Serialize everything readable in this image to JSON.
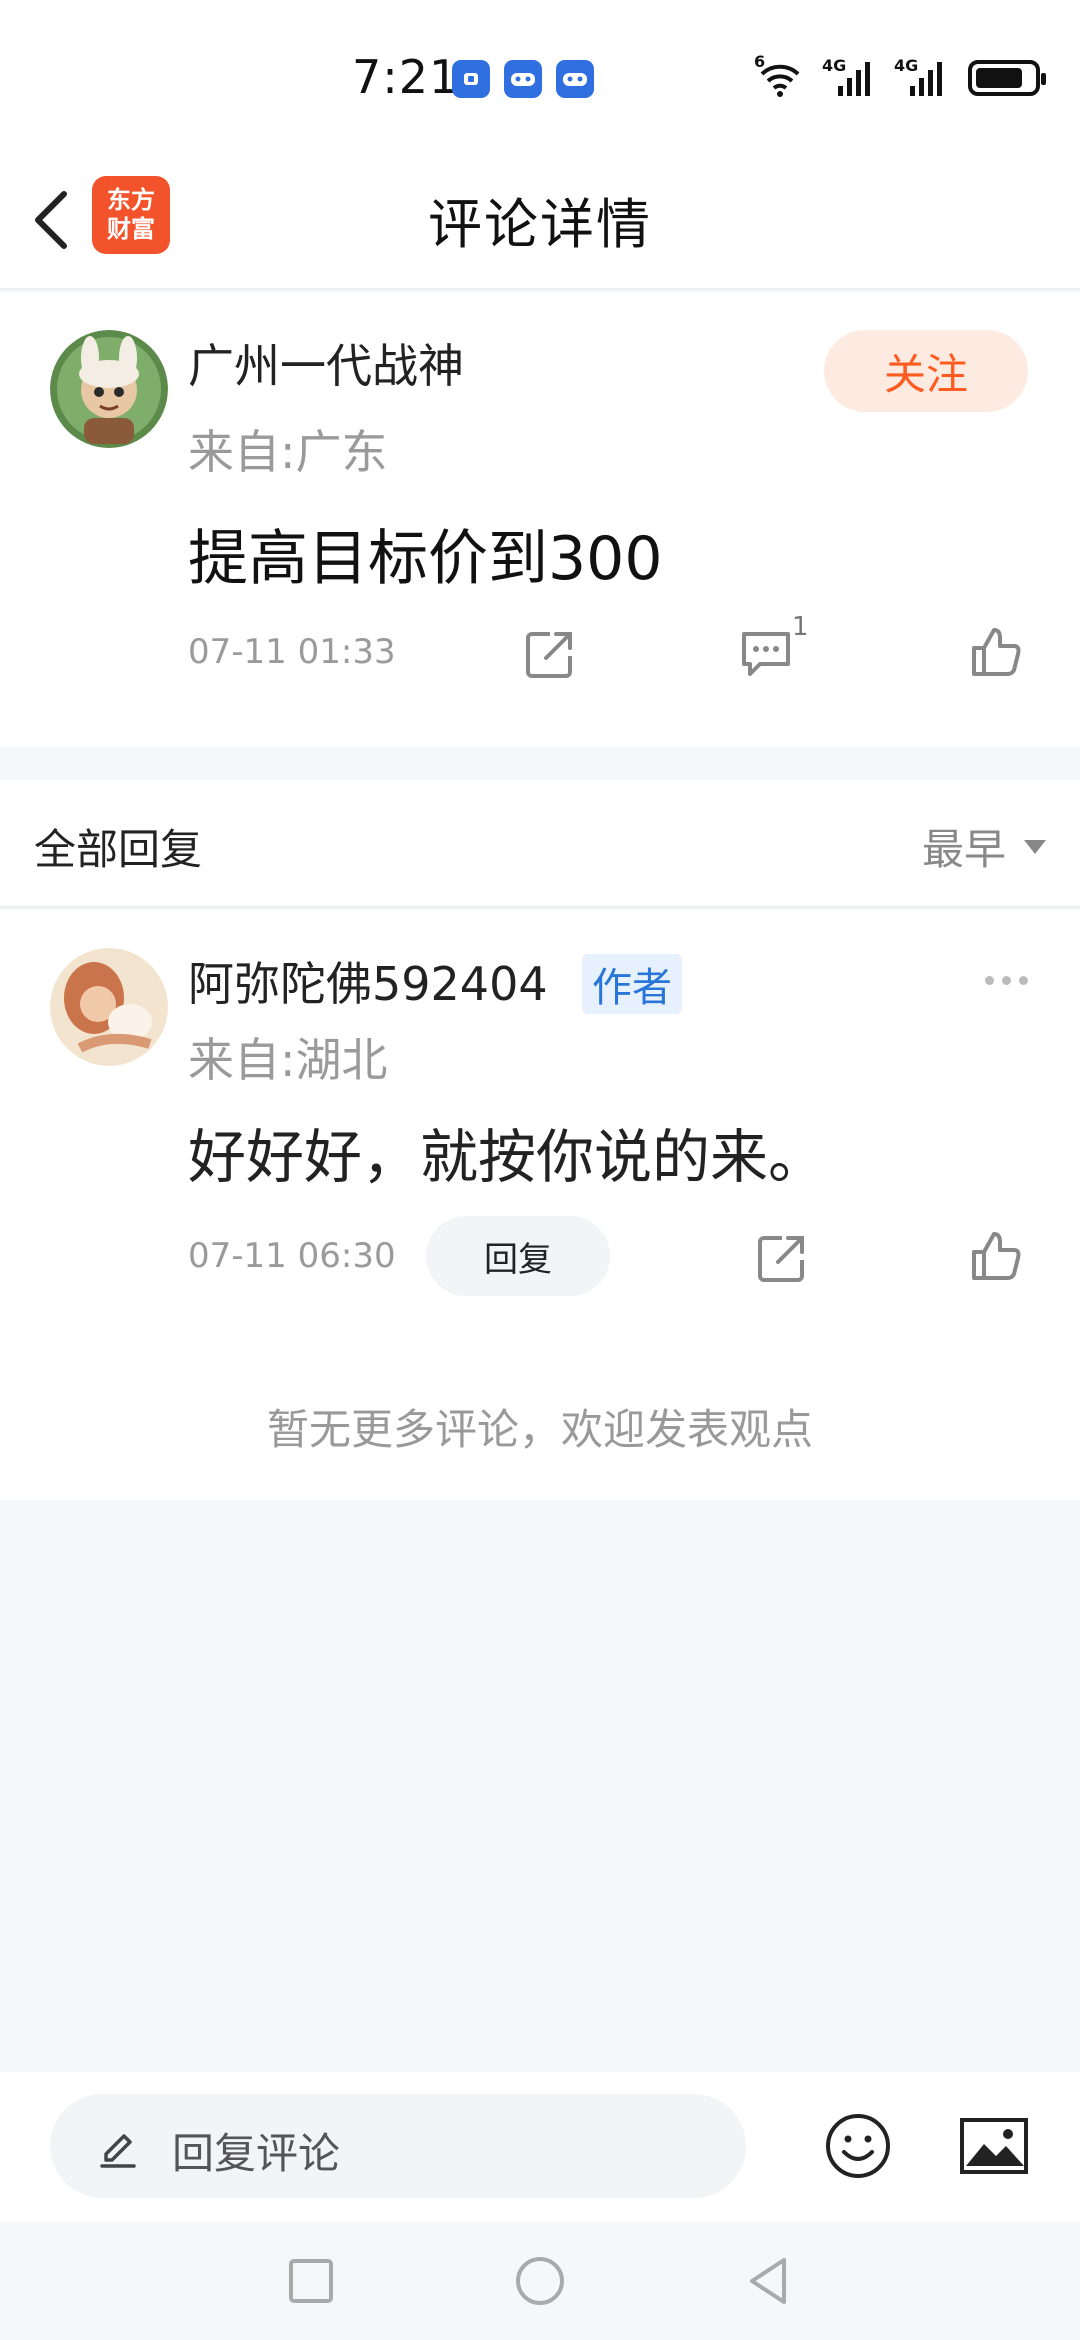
{
  "status_bar": {
    "time": "7:21",
    "wifi_label": "6",
    "signal1_label": "4G",
    "signal2_label": "4G",
    "battery_level": 0.75,
    "app_icons": [
      "controller-icon",
      "gamepad-icon",
      "gamepad-icon"
    ]
  },
  "nav": {
    "title": "评论详情",
    "logo_line1": "东方",
    "logo_line2": "财富"
  },
  "main_comment": {
    "username": "广州一代战神",
    "location": "来自:广东",
    "follow_label": "关注",
    "content": "提高目标价到300",
    "time": "07-11 01:33",
    "reply_count": "1"
  },
  "replies_section": {
    "title": "全部回复",
    "sort_label": "最早"
  },
  "reply": {
    "username": "阿弥陀佛592404",
    "author_tag": "作者",
    "location": "来自:湖北",
    "content": "好好好，就按你说的来。",
    "time": "07-11 06:30",
    "reply_button": "回复"
  },
  "no_more_text": "暂无更多评论，欢迎发表观点",
  "bottom_bar": {
    "input_placeholder": "回复评论"
  },
  "colors": {
    "accent": "#ff5a1f",
    "author_tag": "#2a76d8",
    "logo": "#f2532a"
  }
}
